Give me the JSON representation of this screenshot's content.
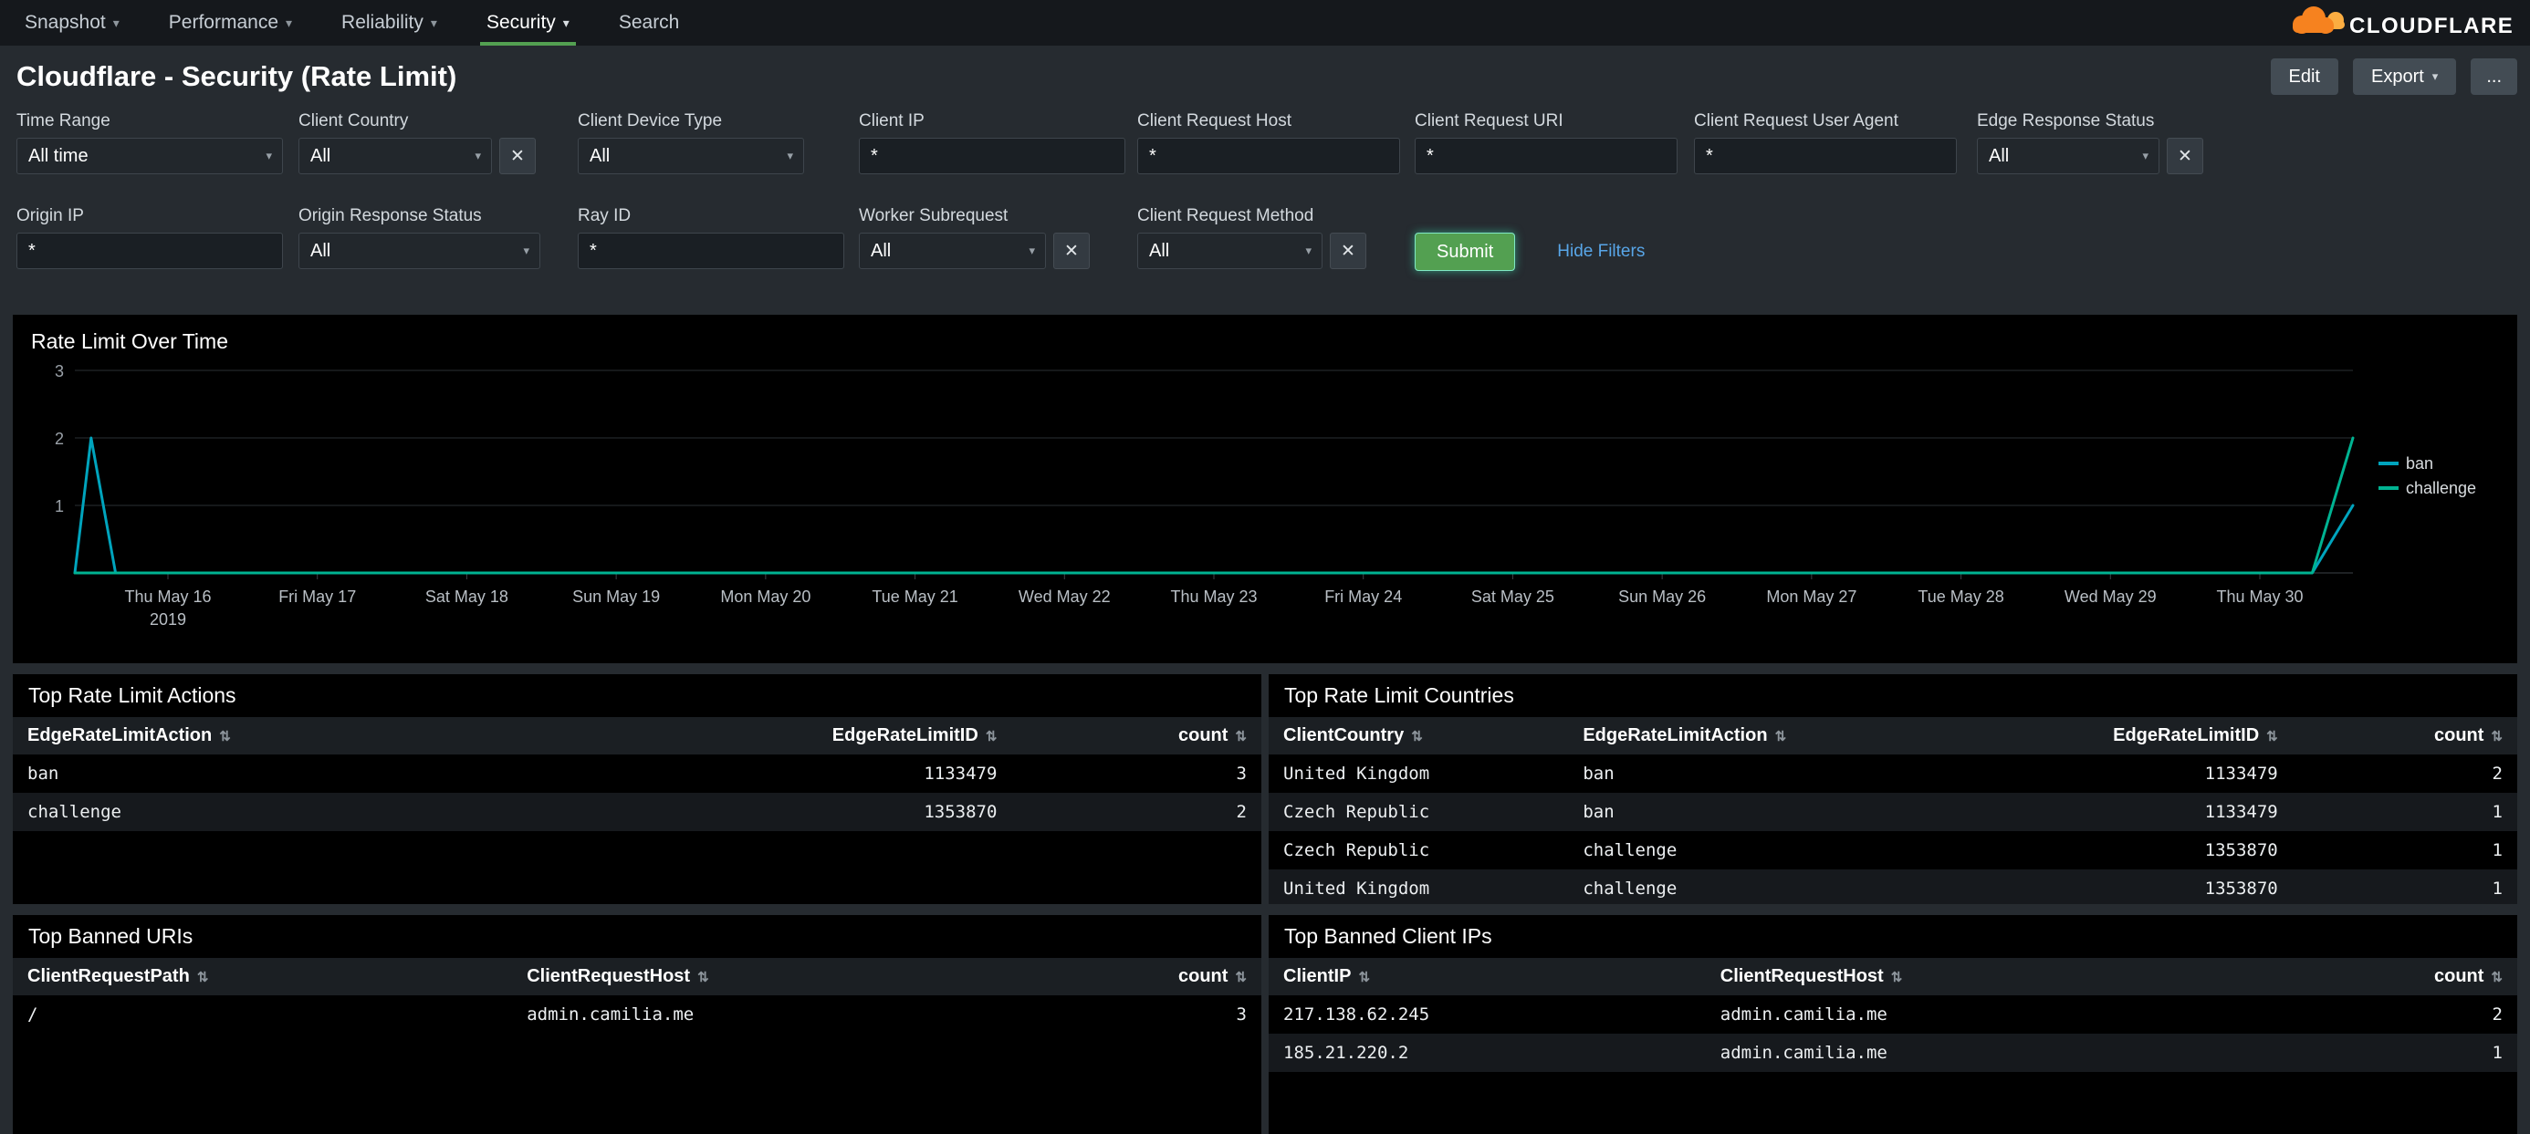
{
  "nav": {
    "items": [
      {
        "label": "Snapshot",
        "caret": true,
        "active": false
      },
      {
        "label": "Performance",
        "caret": true,
        "active": false
      },
      {
        "label": "Reliability",
        "caret": true,
        "active": false
      },
      {
        "label": "Security",
        "caret": true,
        "active": true
      },
      {
        "label": "Search",
        "caret": false,
        "active": false
      }
    ],
    "logo_text": "CLOUDFLARE"
  },
  "header": {
    "title": "Cloudflare - Security (Rate Limit)",
    "edit_label": "Edit",
    "export_label": "Export",
    "more_label": "..."
  },
  "filters": {
    "submit_label": "Submit",
    "hide_filters_label": "Hide Filters",
    "row1": [
      {
        "label": "Time Range",
        "type": "dropdown",
        "value": "All time",
        "clear": false
      },
      {
        "label": "Client Country",
        "type": "dropdown",
        "value": "All",
        "clear": true
      },
      {
        "label": "Client Device Type",
        "type": "dropdown",
        "value": "All",
        "clear": false
      },
      {
        "label": "Client IP",
        "type": "input",
        "value": "*",
        "clear": false
      },
      {
        "label": "Client Request Host",
        "type": "input",
        "value": "*",
        "clear": false
      },
      {
        "label": "Client Request URI",
        "type": "input",
        "value": "*",
        "clear": false
      },
      {
        "label": "Client Request User Agent",
        "type": "input",
        "value": "*",
        "clear": false
      },
      {
        "label": "Edge Response Status",
        "type": "dropdown",
        "value": "All",
        "clear": true
      }
    ],
    "row2": [
      {
        "label": "Origin IP",
        "type": "input",
        "value": "*",
        "clear": false
      },
      {
        "label": "Origin Response Status",
        "type": "dropdown",
        "value": "All",
        "clear": false
      },
      {
        "label": "Ray ID",
        "type": "input",
        "value": "*",
        "clear": false
      },
      {
        "label": "Worker Subrequest",
        "type": "dropdown",
        "value": "All",
        "clear": true
      },
      {
        "label": "Client Request Method",
        "type": "dropdown",
        "value": "All",
        "clear": true
      }
    ]
  },
  "chart_data": {
    "type": "line",
    "title": "Rate Limit Over Time",
    "x_tick_labels": [
      "Thu May 16",
      "Fri May 17",
      "Sat May 18",
      "Sun May 19",
      "Mon May 20",
      "Tue May 21",
      "Wed May 22",
      "Thu May 23",
      "Fri May 24",
      "Sat May 25",
      "Sun May 26",
      "Mon May 27",
      "Tue May 28",
      "Wed May 29",
      "Thu May 30"
    ],
    "x_year_label": "2019",
    "ylim": [
      0,
      3
    ],
    "yticks": [
      1,
      2,
      3
    ],
    "grid": "horizontal",
    "legend_position": "right",
    "series": [
      {
        "name": "ban",
        "color": "#00a4bd",
        "points": [
          [
            0,
            0
          ],
          [
            0.1,
            2
          ],
          [
            0.25,
            0
          ],
          [
            13.75,
            0
          ],
          [
            14,
            1
          ]
        ]
      },
      {
        "name": "challenge",
        "color": "#00b392",
        "points": [
          [
            0,
            0
          ],
          [
            13.75,
            0
          ],
          [
            14,
            2
          ]
        ]
      }
    ]
  },
  "tables": {
    "actions": {
      "title": "Top Rate Limit Actions",
      "columns": [
        {
          "label": "EdgeRateLimitAction",
          "align": "left",
          "width": "45%"
        },
        {
          "label": "EdgeRateLimitID",
          "align": "right",
          "width": "35%"
        },
        {
          "label": "count",
          "align": "right",
          "width": "20%"
        }
      ],
      "rows": [
        [
          "ban",
          "1133479",
          "3"
        ],
        [
          "challenge",
          "1353870",
          "2"
        ]
      ]
    },
    "countries": {
      "title": "Top Rate Limit Countries",
      "columns": [
        {
          "label": "ClientCountry",
          "align": "left",
          "width": "24%"
        },
        {
          "label": "EdgeRateLimitAction",
          "align": "left",
          "width": "30%"
        },
        {
          "label": "EdgeRateLimitID",
          "align": "right",
          "width": "28%"
        },
        {
          "label": "count",
          "align": "right",
          "width": "18%"
        }
      ],
      "rows": [
        [
          "United Kingdom",
          "ban",
          "1133479",
          "2"
        ],
        [
          "Czech Republic",
          "ban",
          "1133479",
          "1"
        ],
        [
          "Czech Republic",
          "challenge",
          "1353870",
          "1"
        ],
        [
          "United Kingdom",
          "challenge",
          "1353870",
          "1"
        ]
      ]
    },
    "banned_uris": {
      "title": "Top Banned URIs",
      "columns": [
        {
          "label": "ClientRequestPath",
          "align": "left",
          "width": "40%"
        },
        {
          "label": "ClientRequestHost",
          "align": "left",
          "width": "40%"
        },
        {
          "label": "count",
          "align": "right",
          "width": "20%"
        }
      ],
      "rows": [
        [
          "/",
          "admin.camilia.me",
          "3"
        ]
      ]
    },
    "banned_ips": {
      "title": "Top Banned Client IPs",
      "columns": [
        {
          "label": "ClientIP",
          "align": "left",
          "width": "35%"
        },
        {
          "label": "ClientRequestHost",
          "align": "left",
          "width": "43%"
        },
        {
          "label": "count",
          "align": "right",
          "width": "22%"
        }
      ],
      "rows": [
        [
          "217.138.62.245",
          "admin.camilia.me",
          "2"
        ],
        [
          "185.21.220.2",
          "admin.camilia.me",
          "1"
        ]
      ]
    }
  },
  "icons": {
    "caret_down": "▾",
    "clear": "✕",
    "sort": "⇅"
  },
  "colors": {
    "nav_active_underline": "#53a051",
    "submit_green": "#53a051",
    "link_blue": "#58a6e8",
    "brand_orange": "#f6821f",
    "brand_orange_light": "#fbad41"
  }
}
